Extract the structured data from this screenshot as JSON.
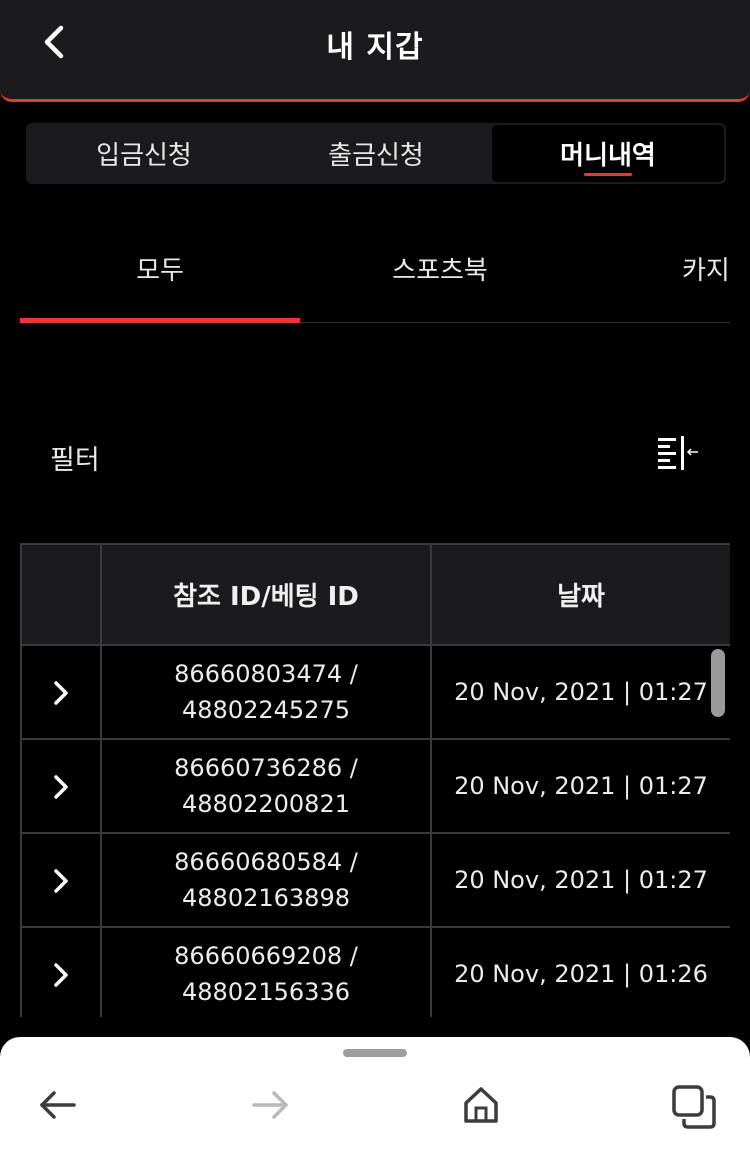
{
  "header": {
    "title": "내 지갑",
    "back_icon": "chevron-left-icon"
  },
  "segments": [
    {
      "label": "입금신청",
      "active": false
    },
    {
      "label": "출금신청",
      "active": false
    },
    {
      "label": "머니내역",
      "active": true
    }
  ],
  "category_tabs": [
    {
      "label": "모두",
      "active": true
    },
    {
      "label": "스포츠북",
      "active": false
    },
    {
      "label": "카지",
      "active": false
    }
  ],
  "filter": {
    "label": "필터",
    "icon": "collapse-filter-icon"
  },
  "table": {
    "headers": [
      "",
      "참조 ID/베팅 ID",
      "날짜"
    ],
    "rows": [
      {
        "ref_id": "86660803474 /",
        "bet_id": "48802245275",
        "date": "20 Nov, 2021 | 01:27"
      },
      {
        "ref_id": "86660736286 /",
        "bet_id": "48802200821",
        "date": "20 Nov, 2021 | 01:27"
      },
      {
        "ref_id": "86660680584 /",
        "bet_id": "48802163898",
        "date": "20 Nov, 2021 | 01:27"
      },
      {
        "ref_id": "86660669208 /",
        "bet_id": "48802156336",
        "date": "20 Nov, 2021 | 01:26"
      }
    ]
  },
  "browser_nav": {
    "icons": [
      "back-arrow-icon",
      "forward-arrow-icon",
      "home-icon",
      "tabs-icon"
    ]
  },
  "colors": {
    "accent": "#e53935",
    "header_bg": "#1b1b1d",
    "page_bg": "#000000"
  }
}
